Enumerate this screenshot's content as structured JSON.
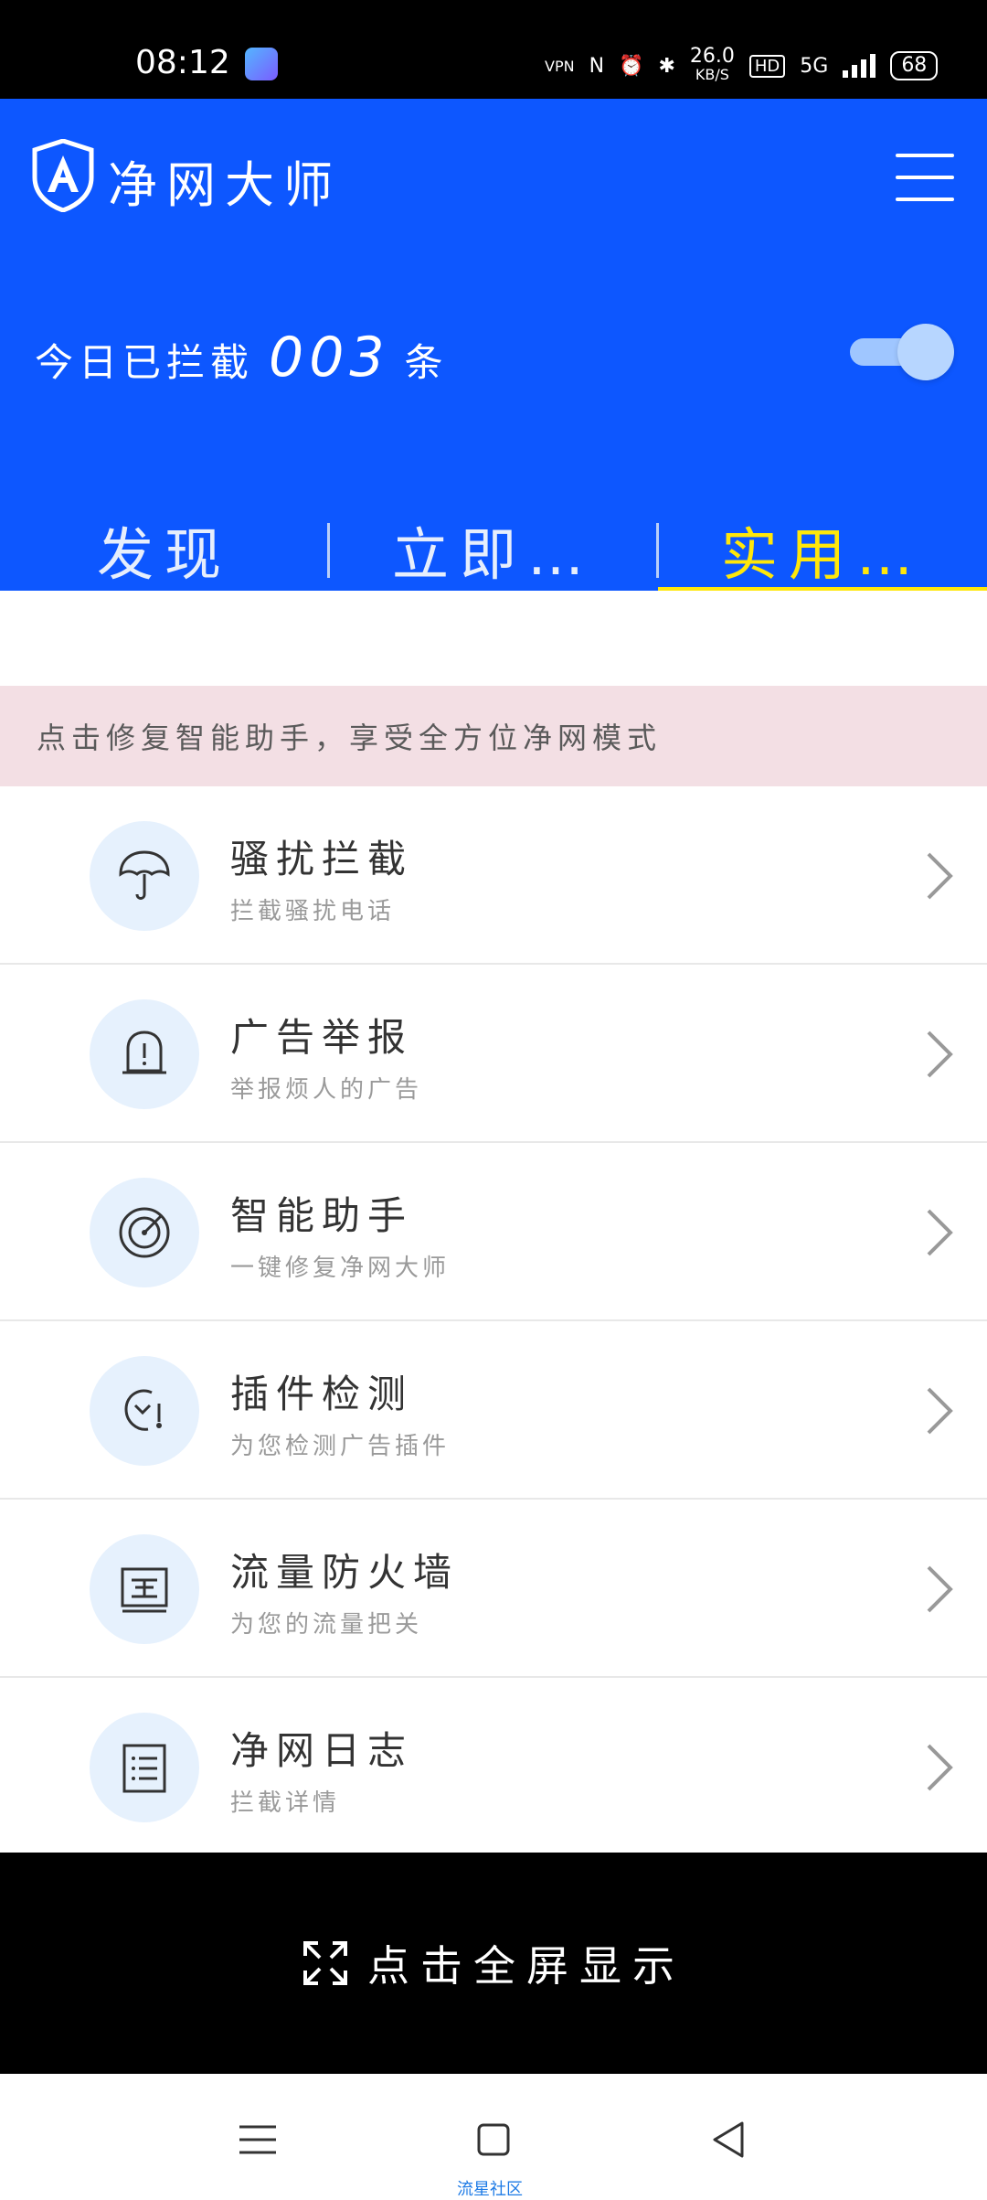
{
  "status": {
    "time": "08:12",
    "vpn": "VPN",
    "speed_value": "26.0",
    "speed_unit": "KB/S",
    "hd": "HD",
    "network": "5G",
    "battery": "68"
  },
  "header": {
    "app_name": "净网大师",
    "blocked_prefix": "今日已拦截",
    "blocked_count": "003",
    "blocked_suffix": "条"
  },
  "tabs": [
    {
      "label": "发现"
    },
    {
      "label": "立即…"
    },
    {
      "label": "实用…"
    }
  ],
  "notice": "点击修复智能助手，享受全方位净网模式",
  "items": [
    {
      "title": "骚扰拦截",
      "subtitle": "拦截骚扰电话",
      "icon": "umbrella-icon"
    },
    {
      "title": "广告举报",
      "subtitle": "举报烦人的广告",
      "icon": "alert-bell-icon"
    },
    {
      "title": "智能助手",
      "subtitle": "一键修复净网大师",
      "icon": "radar-icon"
    },
    {
      "title": "插件检测",
      "subtitle": "为您检测广告插件",
      "icon": "wrench-icon"
    },
    {
      "title": "流量防火墙",
      "subtitle": "为您的流量把关",
      "icon": "firewall-icon"
    },
    {
      "title": "净网日志",
      "subtitle": "拦截详情",
      "icon": "log-list-icon"
    }
  ],
  "fullscreen_label": "点击全屏显示",
  "nav_watermark": "流星社区",
  "colors": {
    "header_blue": "#0d57ff",
    "active_tab": "#ffe70a",
    "notice_bg": "#f3dfe4",
    "icon_circle": "#e6f1fd"
  }
}
